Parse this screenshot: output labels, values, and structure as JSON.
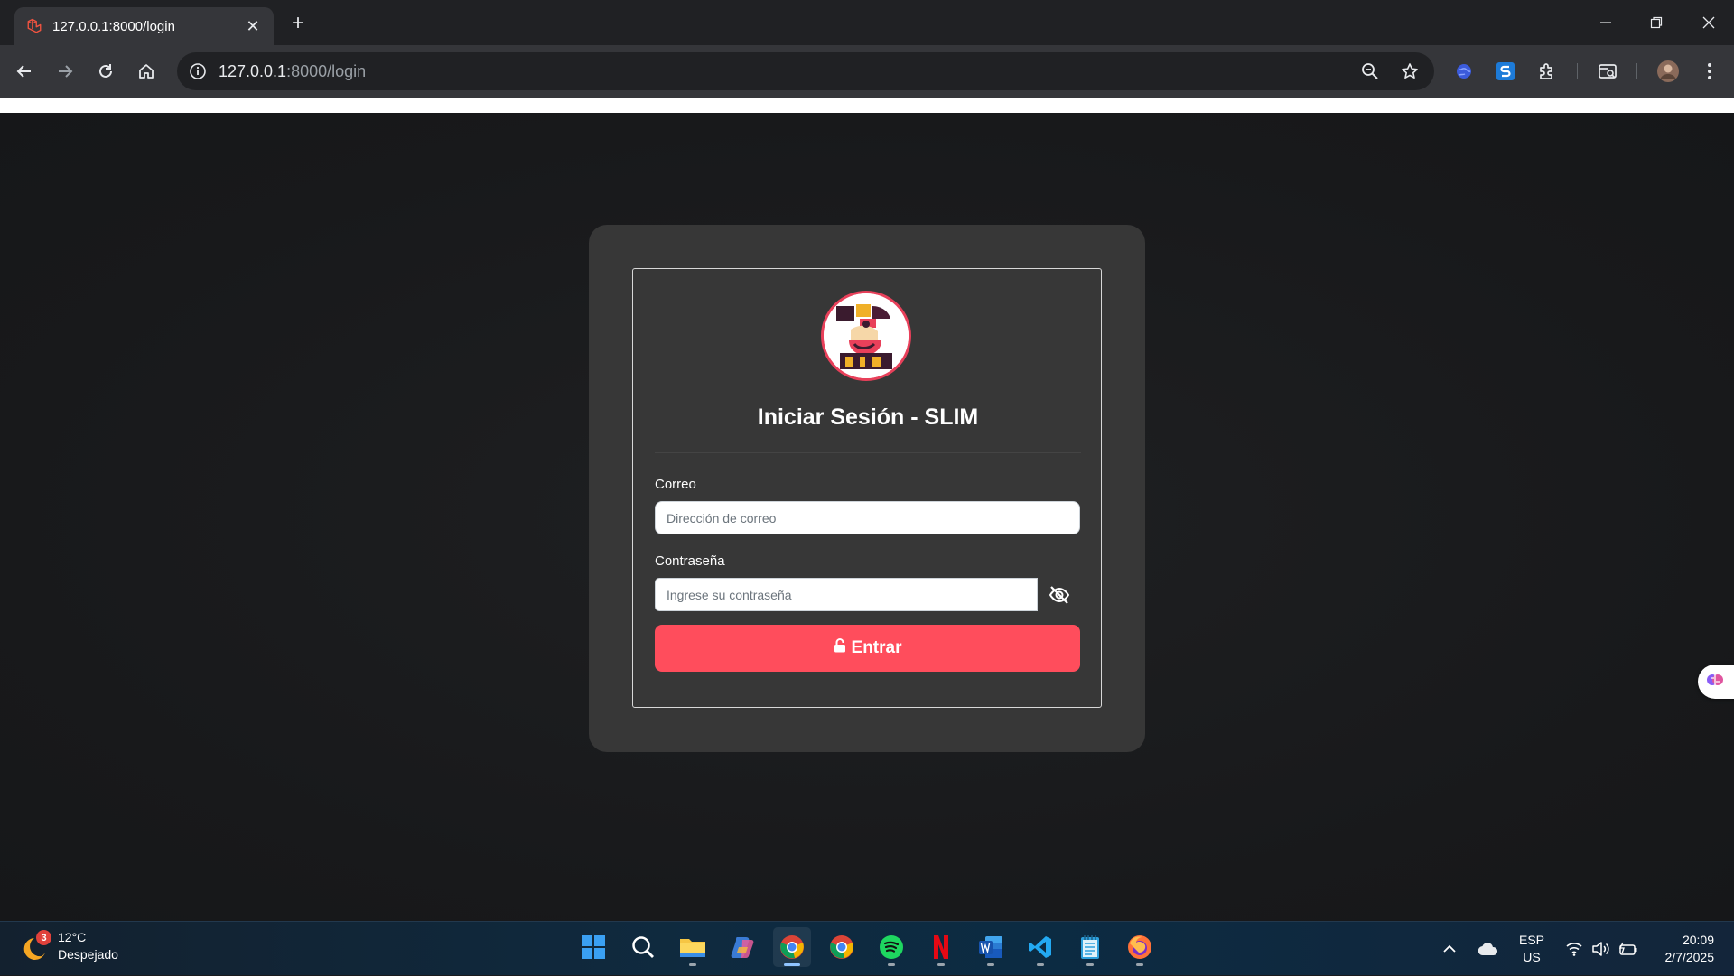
{
  "browser": {
    "tab_title": "127.0.0.1:8000/login",
    "url_host": "127.0.0.1",
    "url_rest": ":8000/login"
  },
  "login": {
    "title": "Iniciar Sesión - SLIM",
    "email_label": "Correo",
    "email_placeholder": "Dirección de correo",
    "password_label": "Contraseña",
    "password_placeholder": "Ingrese su contraseña",
    "submit_label": "Entrar",
    "accent_color": "#ff4d5c"
  },
  "taskbar": {
    "weather_temp": "12°C",
    "weather_desc": "Despejado",
    "weather_badge": "3",
    "language": "ESP",
    "layout": "US",
    "time": "20:09",
    "date": "2/7/2025"
  }
}
